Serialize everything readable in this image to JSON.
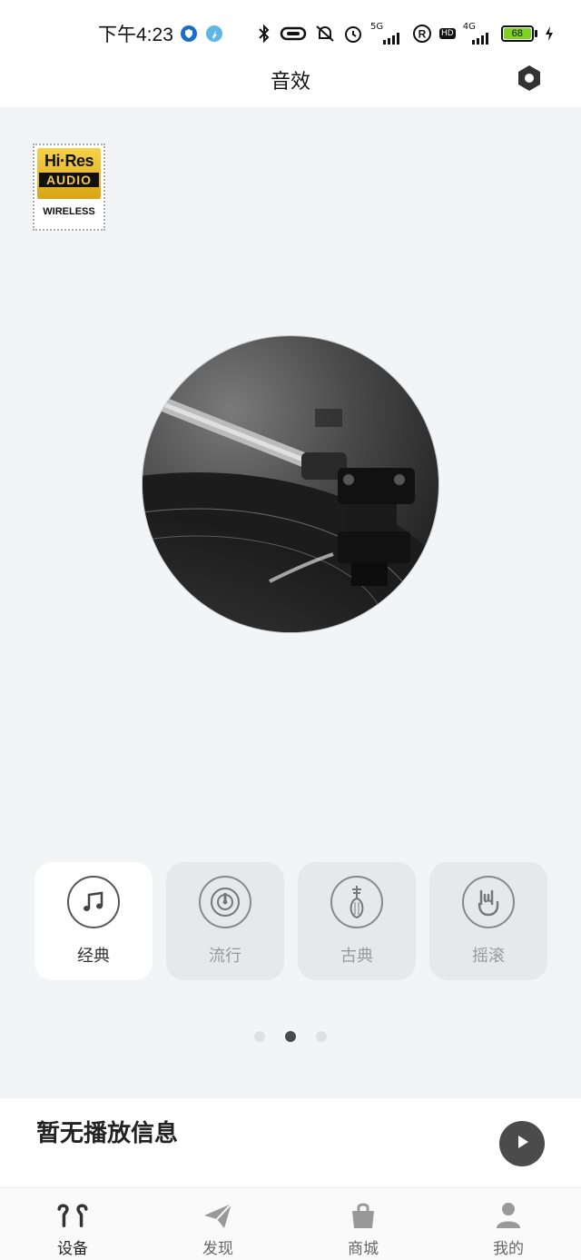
{
  "status_bar": {
    "time": "下午4:23",
    "network_5g": "5G",
    "network_4g": "4G",
    "hd": "HD",
    "battery": "68",
    "battery_color": "#7ed321"
  },
  "header": {
    "title": "音效",
    "settings_icon": "hexagon-settings-icon"
  },
  "hires_badge": {
    "brand": "Hi·Res",
    "audio": "AUDIO",
    "wireless": "WIRELESS"
  },
  "modes": [
    {
      "label": "经典",
      "icon": "music-note-icon",
      "active": true
    },
    {
      "label": "流行",
      "icon": "disc-icon",
      "active": false
    },
    {
      "label": "古典",
      "icon": "pipa-icon",
      "active": false
    },
    {
      "label": "摇滚",
      "icon": "rock-hand-icon",
      "active": false
    }
  ],
  "pager": {
    "count": 3,
    "active_index": 1
  },
  "player": {
    "info": "暂无播放信息",
    "play_icon": "play-icon"
  },
  "tabs": [
    {
      "label": "设备",
      "icon": "earbuds-icon",
      "active": true
    },
    {
      "label": "发现",
      "icon": "paper-plane-icon",
      "active": false
    },
    {
      "label": "商城",
      "icon": "shopping-bag-icon",
      "active": false
    },
    {
      "label": "我的",
      "icon": "person-icon",
      "active": false
    }
  ],
  "colors": {
    "background": "#f3f4f6",
    "card_inactive": "#e7e8ea",
    "card_active": "#ffffff",
    "play_button": "#4b4b4b"
  }
}
